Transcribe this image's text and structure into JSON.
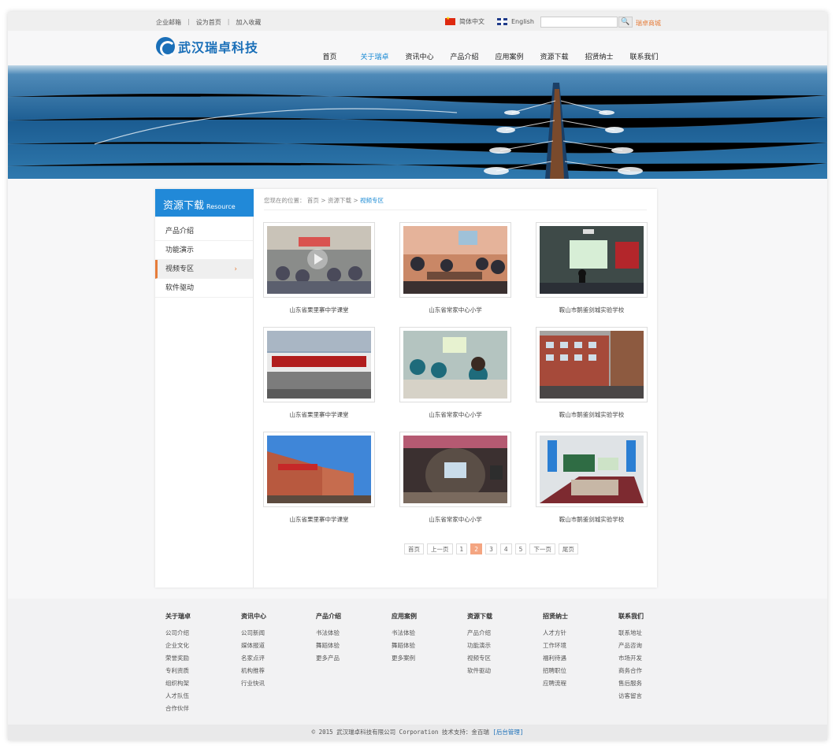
{
  "topbar": {
    "links": [
      "企业邮箱",
      "设为首页",
      "加入收藏"
    ],
    "lang_cn": "简体中文",
    "lang_en": "English",
    "search_placeholder": "",
    "search_btn": "🔍",
    "mall": "瑞卓商城"
  },
  "header": {
    "logo_text": "武汉瑞卓科技",
    "nav": [
      "首页",
      "关于瑞卓",
      "资讯中心",
      "产品介绍",
      "应用案例",
      "资源下载",
      "招贤纳士",
      "联系我们"
    ],
    "nav_active": 1
  },
  "sidebar": {
    "title": "资源下载",
    "title_en": "Resource",
    "items": [
      "产品介绍",
      "功能演示",
      "视频专区",
      "软件驱动"
    ],
    "active": 2
  },
  "breadcrumb": {
    "prefix": "您现在的位置：",
    "home": "首页",
    "parent": "资源下载",
    "current": "视频专区",
    "sep": ">"
  },
  "videos": [
    {
      "caption": "山东省栗里寨中学课堂"
    },
    {
      "caption": "山东省常家中心小学"
    },
    {
      "caption": "鞍山市鹅鉴剑城实验学校"
    },
    {
      "caption": "山东省栗里寨中学课堂"
    },
    {
      "caption": "山东省常家中心小学"
    },
    {
      "caption": "鞍山市鹅鉴剑城实验学校"
    },
    {
      "caption": "山东省栗里寨中学课堂"
    },
    {
      "caption": "山东省常家中心小学"
    },
    {
      "caption": "鞍山市鹅鉴剑城实验学校"
    }
  ],
  "pager": {
    "first": "首页",
    "prev": "上一页",
    "pages": [
      "1",
      "2",
      "3",
      "4",
      "5"
    ],
    "current": "2",
    "next": "下一页",
    "last": "尾页"
  },
  "footer": {
    "columns": [
      {
        "title": "关于瑞卓",
        "links": [
          "公司介绍",
          "企业文化",
          "荣誉奖励",
          "专利资质",
          "组织构架",
          "人才队伍",
          "合作伙伴"
        ]
      },
      {
        "title": "资讯中心",
        "links": [
          "公司新闻",
          "媒体报道",
          "名家点评",
          "机构推荐",
          "行业快讯"
        ]
      },
      {
        "title": "产品介绍",
        "links": [
          "书法体验",
          "舞蹈体验",
          "更多产品"
        ]
      },
      {
        "title": "应用案例",
        "links": [
          "书法体验",
          "舞蹈体验",
          "更多案例"
        ]
      },
      {
        "title": "资源下载",
        "links": [
          "产品介绍",
          "功能演示",
          "视频专区",
          "软件驱动"
        ]
      },
      {
        "title": "招贤纳士",
        "links": [
          "人才方针",
          "工作环境",
          "福利待遇",
          "招聘职位",
          "应聘流程"
        ]
      },
      {
        "title": "联系我们",
        "links": [
          "联系地址",
          "产品咨询",
          "市场开发",
          "商务合作",
          "售后服务",
          "访客留言"
        ]
      }
    ],
    "copyright": "© 2015 武汉瑞卓科技有限公司 Corporation 技术支持：金百瑞",
    "admin": "[后台管理]"
  }
}
